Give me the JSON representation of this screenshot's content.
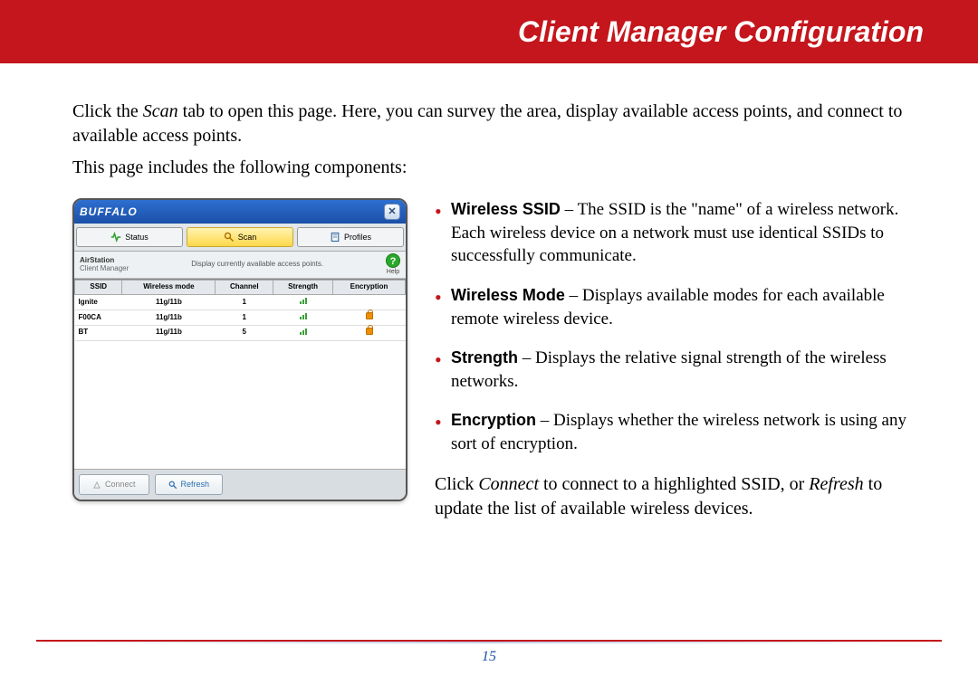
{
  "header": {
    "title": "Client Manager Configuration"
  },
  "intro": {
    "p1a": "Click the ",
    "p1em": "Scan",
    "p1b": " tab to open this page. Here, you can survey the area, display available access points, and connect to available access points.",
    "p2": "This page includes the following components:"
  },
  "app": {
    "brand": "BUFFALO",
    "close": "✕",
    "tabs": {
      "status": "Status",
      "scan": "Scan",
      "profiles": "Profiles"
    },
    "sub": {
      "line1": "AirStation",
      "line2": "Client Manager",
      "center": "Display currently available access points.",
      "help": "?",
      "help_label": "Help"
    },
    "columns": {
      "ssid": "SSID",
      "mode": "Wireless mode",
      "channel": "Channel",
      "strength": "Strength",
      "encryption": "Encryption"
    },
    "rows": [
      {
        "ssid": "Ignite",
        "mode": "11g/11b",
        "channel": "1",
        "encrypted": false
      },
      {
        "ssid": "F00CA",
        "mode": "11g/11b",
        "channel": "1",
        "encrypted": true
      },
      {
        "ssid": "BT",
        "mode": "11g/11b",
        "channel": "5",
        "encrypted": true
      }
    ],
    "buttons": {
      "connect": "Connect",
      "refresh": "Refresh"
    }
  },
  "bullets": [
    {
      "term": "Wireless SSID",
      "desc": " – The SSID is the \"name\" of a wireless network. Each wireless device on a network must use identical SSIDs to successfully communicate."
    },
    {
      "term": "Wireless Mode",
      "desc": " – Displays available modes for each available remote wireless device."
    },
    {
      "term": "Strength",
      "desc": " – Displays the relative signal strength of the wireless networks."
    },
    {
      "term": "Encryption",
      "desc": " – Displays whether the wireless network is using any sort of encryption."
    }
  ],
  "closing": {
    "a": "Click ",
    "em1": "Connect",
    "b": " to connect to a highlighted SSID, or ",
    "em2": "Refresh",
    "c": " to update the list of available wireless devices."
  },
  "page_number": "15"
}
